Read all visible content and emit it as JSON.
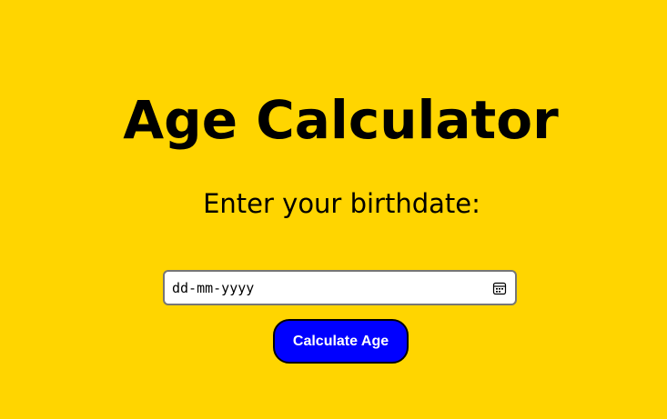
{
  "heading": {
    "title": "Age Calculator",
    "prompt": "Enter your birthdate:"
  },
  "birthdate_input": {
    "placeholder": "dd-mm-yyyy",
    "value": "",
    "icon": "calendar-icon"
  },
  "actions": {
    "calculate_label": "Calculate Age"
  },
  "colors": {
    "background": "#ffd500",
    "button": "#0000ff",
    "button_text": "#ffffff"
  }
}
